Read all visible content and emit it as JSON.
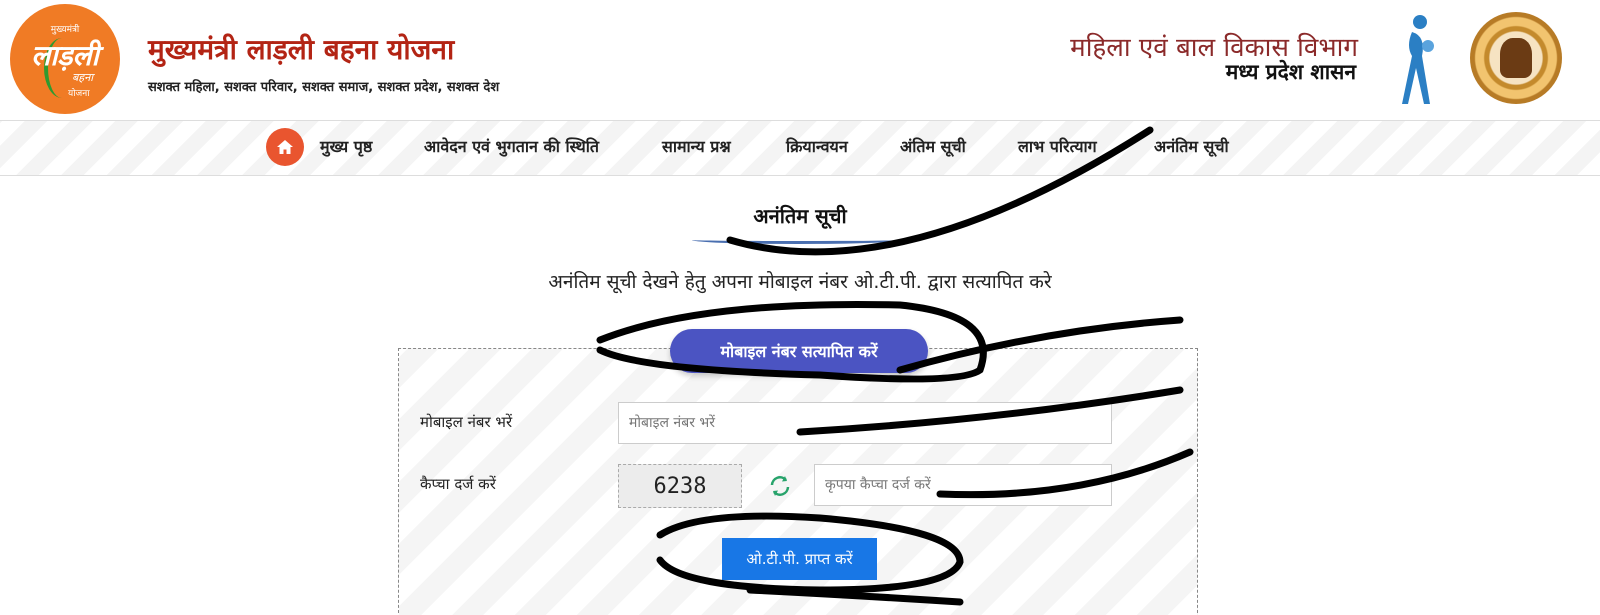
{
  "header": {
    "logo": {
      "small": "मुख्यमंत्री",
      "big": "लाड़ली",
      "mid": "बहना",
      "bottom": "योजना"
    },
    "title": "मुख्यमंत्री लाड़ली बहना योजना",
    "tagline": "सशक्त महिला, सशक्त परिवार, सशक्त समाज, सशक्त प्रदेश, सशक्त देश",
    "dept_name": "महिला एवं बाल विकास विभाग",
    "dept_gov": "मध्य प्रदेश शासन"
  },
  "nav": {
    "items": [
      {
        "label": "मुख्य पृष्ठ"
      },
      {
        "label": "आवेदन एवं भुगतान की स्थिति"
      },
      {
        "label": "सामान्य प्रश्न"
      },
      {
        "label": "क्रियान्वयन"
      },
      {
        "label": "अंतिम सूची"
      },
      {
        "label": "लाभ परित्याग"
      },
      {
        "label": "अनंतिम सूची"
      }
    ]
  },
  "main": {
    "section_title": "अनंतिम सूची",
    "instruction": "अनंतिम सूची देखने हेतु अपना मोबाइल नंबर ओ.टी.पी. द्वारा सत्यापित करे",
    "verify_pill": "मोबाइल नंबर सत्यापित करें",
    "form": {
      "mobile_label": "मोबाइल नंबर भरें",
      "mobile_placeholder": "मोबाइल नंबर भरें",
      "captcha_label": "कैप्चा दर्ज करें",
      "captcha_value": "6238",
      "captcha_placeholder": "कृपया कैप्चा दर्ज करें",
      "otp_button": "ओ.टी.पी. प्राप्त करें"
    }
  },
  "colors": {
    "title": "#b32414",
    "home": "#e9552f",
    "pill": "#4b54c2",
    "button": "#1877e6"
  }
}
